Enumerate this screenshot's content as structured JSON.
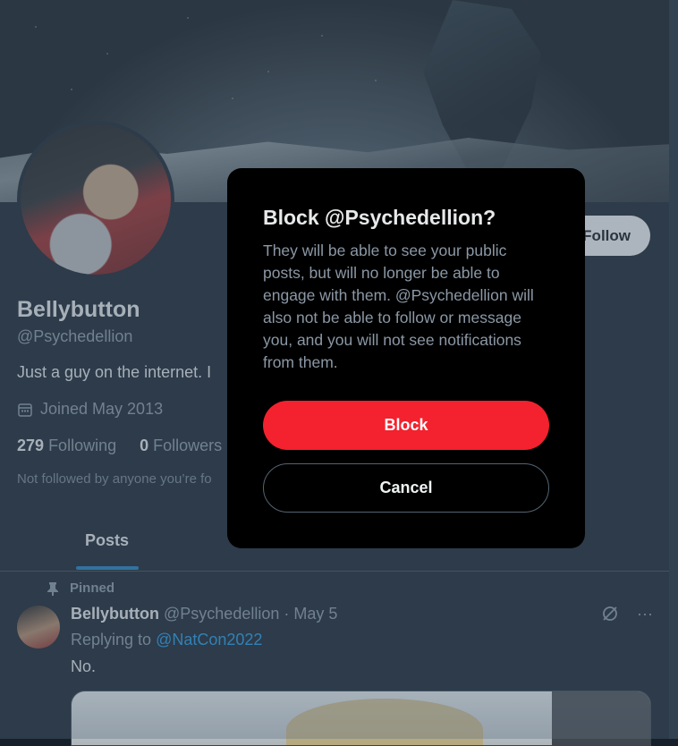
{
  "profile": {
    "follow_label": "Follow",
    "name": "Bellybutton",
    "handle": "@Psychedellion",
    "bio": "Just a guy on the internet. I",
    "joined": "Joined May 2013",
    "following_count": "279",
    "following_label": "Following",
    "followers_count": "0",
    "followers_label": "Followers",
    "not_followed": "Not followed by anyone you’re fo"
  },
  "tabs": {
    "posts": "Posts"
  },
  "post": {
    "pinned_label": "Pinned",
    "author": "Bellybutton",
    "meta": "@Psychedellion · May 5",
    "replying_prefix": "Replying to",
    "replying_to": "@NatCon2022",
    "text": "No.",
    "more_icon": "···"
  },
  "dialog": {
    "title": "Block @Psychedellion?",
    "body": "They will be able to see your public posts, but will no longer be able to engage with them. @Psychedellion will also not be able to follow or message you, and you will not see notifications from them.",
    "block_label": "Block",
    "cancel_label": "Cancel"
  },
  "colors": {
    "background": "#15202b",
    "dialog": "#000000",
    "block": "#f4212e",
    "accent": "#1d9bf0"
  }
}
